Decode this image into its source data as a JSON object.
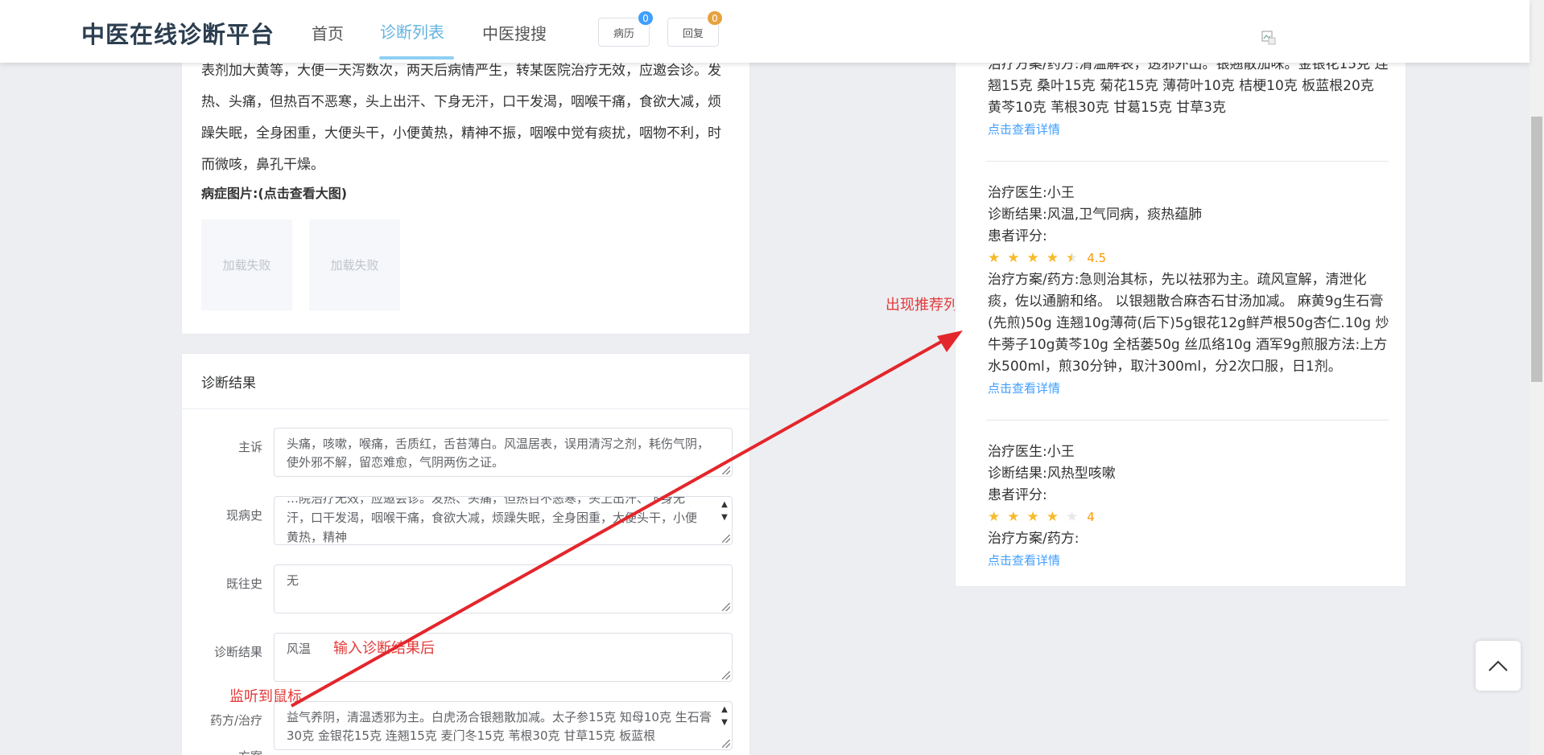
{
  "header": {
    "brand": "中医在线诊断平台",
    "nav": [
      {
        "label": "首页"
      },
      {
        "label": "诊断列表"
      },
      {
        "label": "中医搜搜"
      }
    ],
    "buttons": [
      {
        "label": "病历",
        "badge": "0",
        "badge_color": "#409eff"
      },
      {
        "label": "回复",
        "badge": "0",
        "badge_color": "#e6a23c"
      }
    ]
  },
  "symptom": {
    "text": "表剂加大黄等，大便一天泻数次，两天后病情严生，转某医院治疗无效，应邀会诊。发热、头痛，但热百不恶寒，头上出汗、下身无汗，口干发渴，咽喉干痛，食欲大减，烦躁失眠，全身困重，大便头干，小便黄热，精神不振，咽喉中觉有痰扰，咽物不利，时而微咳，鼻孔干燥。",
    "images_label": "病症图片:(点击查看大图)",
    "image_fail_text": "加载失败"
  },
  "diagnosis": {
    "title": "诊断结果",
    "fields": [
      {
        "label": "主诉",
        "value": "头痛，咳嗽，喉痛，舌质红，舌苔薄白。风温居表，误用清泻之剂，耗伤气阴，使外邪不解，留恋难愈，气阴两伤之证。"
      },
      {
        "label": "现病史",
        "value": "…院治疗无效，应邀会诊。发热、头痛，但热百不恶寒，头上出汗、下身无汗，口干发渴，咽喉干痛，食欲大减，烦躁失眠，全身困重，大便头干，小便黄热，精神"
      },
      {
        "label": "既往史",
        "value": "无"
      },
      {
        "label": "诊断结果",
        "value": "风温"
      },
      {
        "label": "药方/治疗",
        "value": "益气养阴，清温透邪为主。白虎汤合银翘散加减。太子参15克 知母10克 生石膏30克 金银花15克 连翘15克 麦门冬15克 苇根30克 甘草15克 板蓝根"
      },
      {
        "label": "方案"
      }
    ]
  },
  "annotations": {
    "after_input": "输入诊断结果后",
    "mouse_listen": "监听到鼠标",
    "recommend": "出现推荐列表"
  },
  "recommendations": [
    {
      "plan_partial": "治疗方案/药方:清温解表，透邪外出。银翘散加味。金银花15克 连翘15克 桑叶15克 菊花15克 薄荷叶10克 桔梗10克 板蓝根20克 黄芩10克 苇根30克 甘葛15克 甘草3克",
      "link": "点击查看详情"
    },
    {
      "doctor": "治疗医生:小王",
      "result": "诊断结果:风温,卫气同病，痰热蕴肺",
      "rating_label": "患者评分:",
      "rating": 4.5,
      "rating_text": "4.5",
      "plan": "治疗方案/药方:急则治其标，先以祛邪为主。疏风宣解，清泄化痰，佐以通腑和络。 以银翘散合麻杏石甘汤加减。 麻黄9g生石膏(先煎)50g 连翘10g薄荷(后下)5g银花12g鲜芦根50g杏仁.10g 炒牛蒡子10g黄芩10g 全栝蒌50g 丝瓜络10g 酒军9g煎服方法:上方水500ml，煎30分钟，取汁300ml，分2次口服，日1剂。",
      "link": "点击查看详情"
    },
    {
      "doctor": "治疗医生:小王",
      "result": "诊断结果:风热型咳嗽",
      "rating_label": "患者评分:",
      "rating": 4,
      "rating_text": "4",
      "plan": "治疗方案/药方:",
      "link": "点击查看详情"
    }
  ],
  "colors": {
    "accent": "#63b4e0",
    "link": "#409eff",
    "star": "#f7ba2a",
    "annotation": "#e33a3a"
  }
}
